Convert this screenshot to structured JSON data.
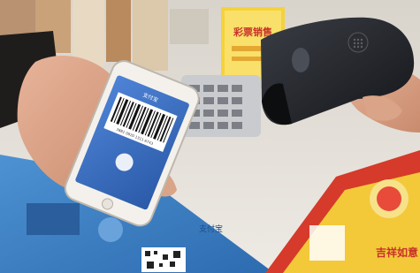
{
  "scene": {
    "description_free": true
  },
  "phone_screen": {
    "app_label": "支付宝",
    "barcode_digits": "2881 0920 1311 6743"
  },
  "poster": {
    "top_text": "彩票销售"
  },
  "ticket": {
    "chars": "吉祥如意"
  },
  "counter": {
    "brand_text": "支付宝"
  },
  "colors": {
    "phone_screen_blue": "#3a6fc0",
    "scanner_black": "#1d1f24",
    "counter_blue": "#3e86c8",
    "ticket_red": "#d63a2a",
    "ticket_yellow": "#f3c93a"
  }
}
